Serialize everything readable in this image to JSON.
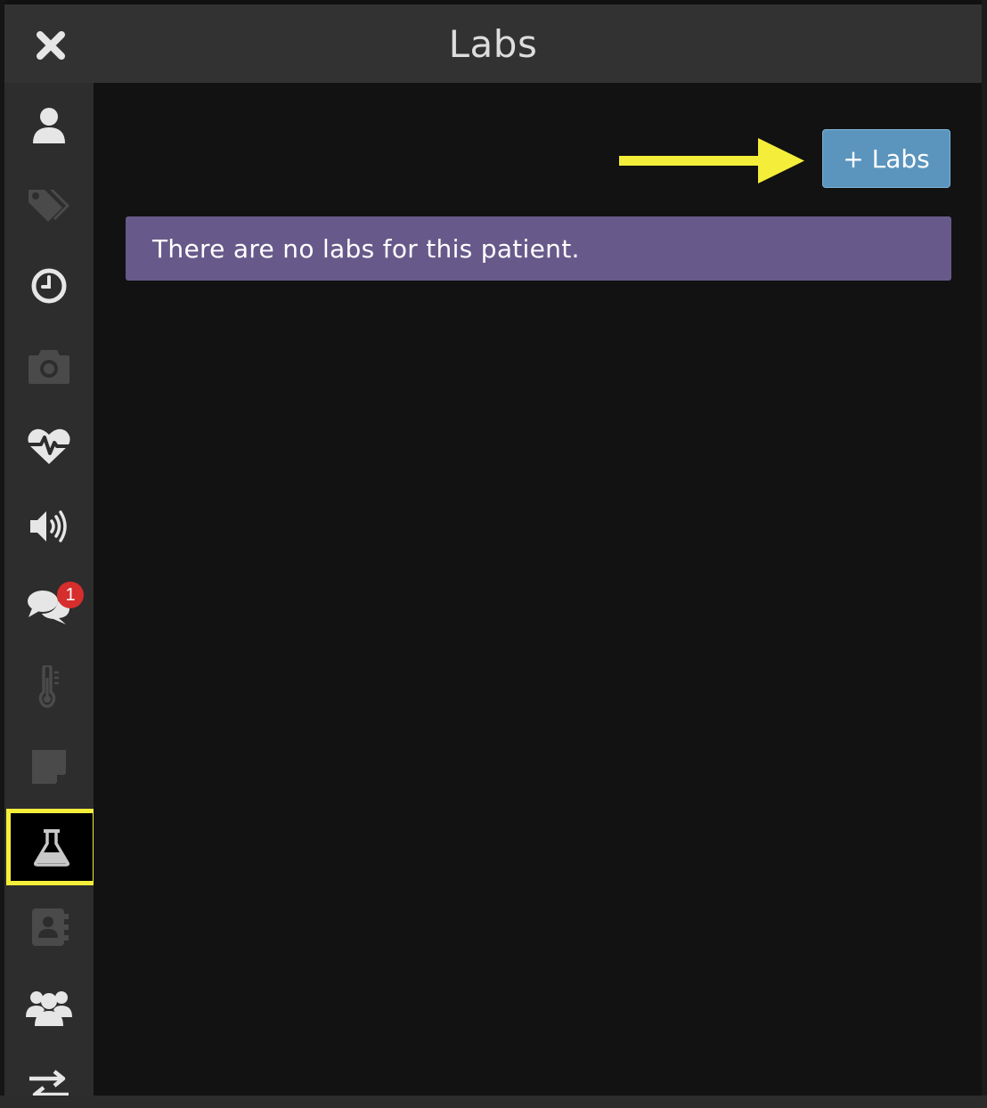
{
  "header": {
    "title": "Labs",
    "close_icon": "close-icon"
  },
  "sidebar": {
    "items": [
      {
        "name": "patient",
        "icon": "user-icon",
        "color": "#e6e6e6"
      },
      {
        "name": "tags",
        "icon": "tags-icon",
        "color": "#4a4a4a"
      },
      {
        "name": "history",
        "icon": "clock-icon",
        "color": "#e6e6e6"
      },
      {
        "name": "photos",
        "icon": "camera-icon",
        "color": "#4a4a4a"
      },
      {
        "name": "vitals",
        "icon": "heartbeat-icon",
        "color": "#e6e6e6"
      },
      {
        "name": "audio",
        "icon": "volume-icon",
        "color": "#e6e6e6"
      },
      {
        "name": "messages",
        "icon": "comments-icon",
        "color": "#e6e6e6",
        "badge": "1"
      },
      {
        "name": "temperature",
        "icon": "thermometer-icon",
        "color": "#4a4a4a"
      },
      {
        "name": "notes",
        "icon": "sticky-note-icon",
        "color": "#4a4a4a"
      },
      {
        "name": "labs",
        "icon": "flask-icon",
        "color": "#c8c8c8",
        "active": true
      },
      {
        "name": "contacts",
        "icon": "address-book-icon",
        "color": "#4a4a4a"
      },
      {
        "name": "team",
        "icon": "users-icon",
        "color": "#e6e6e6"
      },
      {
        "name": "transfer",
        "icon": "exchange-icon",
        "color": "#e6e6e6"
      }
    ]
  },
  "main": {
    "add_button_label": "+ Labs",
    "empty_message": "There are no labs for this patient."
  },
  "colors": {
    "accent_button": "#5b95bd",
    "alert_bg": "#675a8a",
    "highlight": "#f4ee3a",
    "badge": "#d62d2d"
  }
}
